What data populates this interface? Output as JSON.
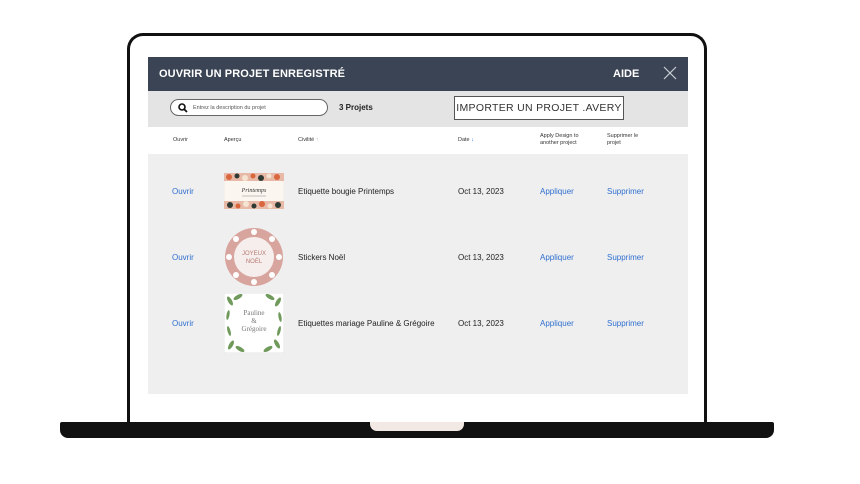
{
  "window": {
    "title": "OUVRIR UN PROJET ENREGISTRÉ",
    "help_label": "AIDE"
  },
  "toolbar": {
    "search_placeholder": "Entrez la description du projet",
    "project_count": "3 Projets",
    "import_label": "IMPORTER UN PROJET .AVERY"
  },
  "table": {
    "headers": {
      "open": "Ouvrir",
      "preview": "Aperçu",
      "name": "Civilité",
      "name_sort_icon": "↑",
      "date": "Date",
      "date_sort_icon": "↓",
      "apply_line1": "Apply Design to",
      "apply_line2": "another project",
      "delete_line1": "Supprimer le",
      "delete_line2": "projet"
    },
    "rows": [
      {
        "open_label": "Ouvrir",
        "name": "Etiquette bougie Printemps",
        "date": "Oct 13, 2023",
        "apply_label": "Appliquer",
        "delete_label": "Supprimer",
        "thumb_text": "Printemps"
      },
      {
        "open_label": "Ouvrir",
        "name": "Stickers Noël",
        "date": "Oct 13, 2023",
        "apply_label": "Appliquer",
        "delete_label": "Supprimer",
        "thumb_line1": "JOYEUX",
        "thumb_line2": "NOËL"
      },
      {
        "open_label": "Ouvrir",
        "name": "Etiquettes mariage Pauline & Grégoire",
        "date": "Oct 13, 2023",
        "apply_label": "Appliquer",
        "delete_label": "Supprimer",
        "thumb_line1": "Pauline",
        "thumb_line2": "&",
        "thumb_line3": "Grégoire"
      }
    ]
  },
  "colors": {
    "titlebar": "#3a4454",
    "link": "#2f6fcf",
    "table_bg": "#efefef"
  }
}
